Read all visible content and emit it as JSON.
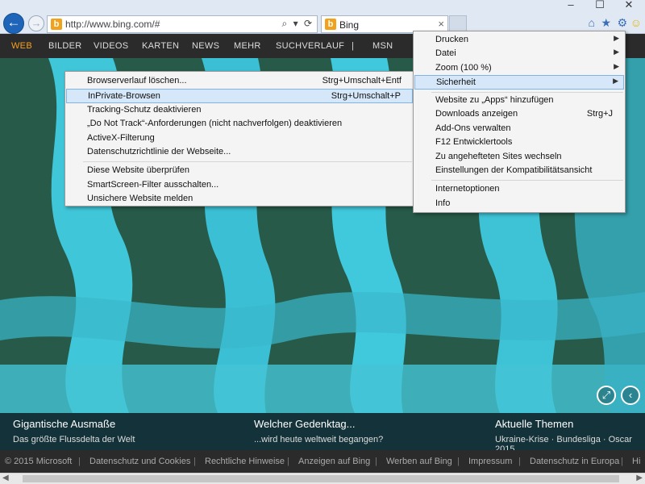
{
  "browser": {
    "url": "http://www.bing.com/#",
    "tab_title": "Bing",
    "colors": {
      "accent": "#1e64b8",
      "highlight": "#d5e7f8"
    }
  },
  "nav": {
    "items": [
      "WEB",
      "BILDER",
      "VIDEOS",
      "KARTEN",
      "NEWS",
      "MEHR",
      "SUCHVERLAUF",
      "|",
      "MSN"
    ],
    "active": "WEB"
  },
  "tools_menu": [
    {
      "label": "Drucken",
      "arrow": true
    },
    {
      "label": "Datei",
      "arrow": true
    },
    {
      "label": "Zoom (100 %)",
      "arrow": true
    },
    {
      "label": "Sicherheit",
      "arrow": true,
      "highlighted": true
    },
    {
      "label": "Website zu „Apps“ hinzufügen"
    },
    {
      "label": "Downloads anzeigen",
      "shortcut": "Strg+J"
    },
    {
      "label": "Add-Ons verwalten"
    },
    {
      "label": "F12 Entwicklertools"
    },
    {
      "label": "Zu angehefteten Sites wechseln"
    },
    {
      "label": "Einstellungen der Kompatibilitätsansicht"
    },
    {
      "label": "Internetoptionen"
    },
    {
      "label": "Info"
    }
  ],
  "security_menu": [
    {
      "label": "Browserverlauf löschen...",
      "shortcut": "Strg+Umschalt+Entf"
    },
    {
      "label": "InPrivate-Browsen",
      "shortcut": "Strg+Umschalt+P",
      "highlighted": true
    },
    {
      "label": "Tracking-Schutz deaktivieren"
    },
    {
      "label": "„Do Not Track“-Anforderungen (nicht nachverfolgen) deaktivieren"
    },
    {
      "label": "ActiveX-Filterung"
    },
    {
      "label": "Datenschutzrichtlinie der Webseite..."
    },
    {
      "label": "Diese Website überprüfen"
    },
    {
      "label": "SmartScreen-Filter ausschalten..."
    },
    {
      "label": "Unsichere Website melden"
    }
  ],
  "info": [
    {
      "title": "Gigantische Ausmaße",
      "sub": "Das größte Flussdelta der Welt"
    },
    {
      "title": "Welcher Gedenktag...",
      "sub": "...wird heute weltweit begangen?"
    },
    {
      "title": "Aktuelle Themen",
      "sub": "Ukraine-Krise · Bundesliga · Oscar 2015"
    }
  ],
  "footer": [
    "© 2015 Microsoft",
    "Datenschutz und Cookies",
    "Rechtliche Hinweise",
    "Anzeigen auf Bing",
    "Werben auf Bing",
    "Impressum",
    "Datenschutz in Europa",
    "Hi"
  ]
}
